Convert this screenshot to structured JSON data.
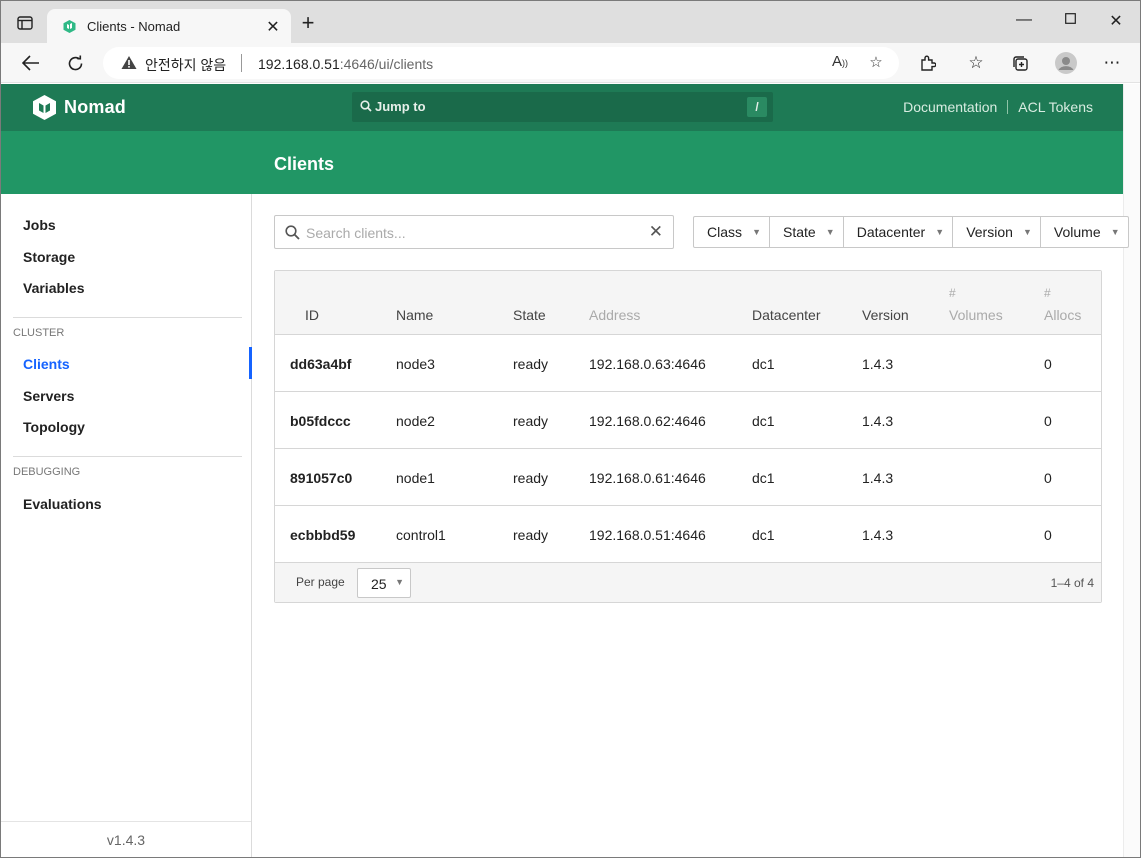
{
  "browser": {
    "tab_title": "Clients - Nomad",
    "security_label": "안전하지 않음",
    "url_host": "192.168.0.51",
    "url_path": ":4646/ui/clients"
  },
  "header": {
    "brand": "Nomad",
    "jump_placeholder": "Jump to",
    "jump_shortcut": "/",
    "links": [
      "Documentation",
      "ACL Tokens"
    ]
  },
  "page": {
    "title": "Clients"
  },
  "sidebar": {
    "top_items": [
      "Jobs",
      "Storage",
      "Variables"
    ],
    "cluster_label": "CLUSTER",
    "cluster_items": [
      "Clients",
      "Servers",
      "Topology"
    ],
    "debugging_label": "DEBUGGING",
    "debugging_items": [
      "Evaluations"
    ],
    "version": "v1.4.3"
  },
  "search": {
    "placeholder": "Search clients..."
  },
  "filters": [
    "Class",
    "State",
    "Datacenter",
    "Version",
    "Volume"
  ],
  "table": {
    "headers": {
      "id": "ID",
      "name": "Name",
      "state": "State",
      "address": "Address",
      "datacenter": "Datacenter",
      "version": "Version",
      "volumes_hash": "#",
      "volumes": "Volumes",
      "allocs_hash": "#",
      "allocs": "Allocs"
    },
    "rows": [
      {
        "id": "dd63a4bf",
        "name": "node3",
        "state": "ready",
        "address": "192.168.0.63:4646",
        "datacenter": "dc1",
        "version": "1.4.3",
        "volumes": "",
        "allocs": "0"
      },
      {
        "id": "b05fdccc",
        "name": "node2",
        "state": "ready",
        "address": "192.168.0.62:4646",
        "datacenter": "dc1",
        "version": "1.4.3",
        "volumes": "",
        "allocs": "0"
      },
      {
        "id": "891057c0",
        "name": "node1",
        "state": "ready",
        "address": "192.168.0.61:4646",
        "datacenter": "dc1",
        "version": "1.4.3",
        "volumes": "",
        "allocs": "0"
      },
      {
        "id": "ecbbbd59",
        "name": "control1",
        "state": "ready",
        "address": "192.168.0.51:4646",
        "datacenter": "dc1",
        "version": "1.4.3",
        "volumes": "",
        "allocs": "0"
      }
    ],
    "per_page_label": "Per page",
    "per_page_value": "25",
    "pagination": "1–4 of 4"
  },
  "colors": {
    "nav_dark": "#1e7a55",
    "nav": "#219665",
    "active_link": "#1563ff"
  }
}
